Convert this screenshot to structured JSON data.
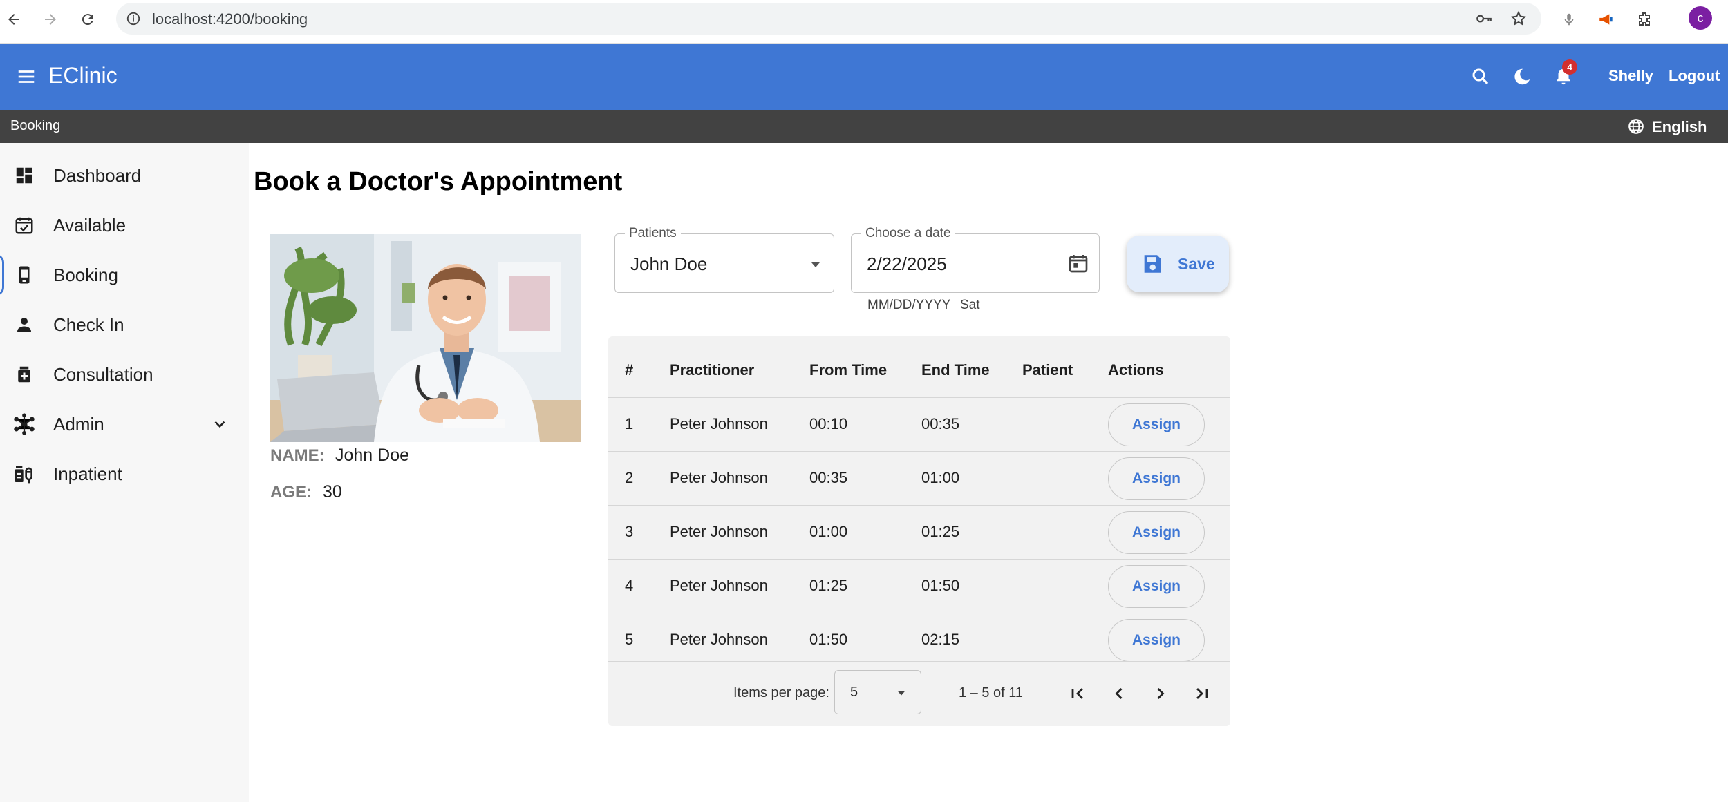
{
  "browser": {
    "url": "localhost:4200/booking",
    "profile_initial": "c",
    "icons": [
      "back-icon",
      "forward-icon",
      "reload-icon",
      "site-info-icon",
      "key-icon",
      "star-icon",
      "mic-icon",
      "megaphone-icon",
      "extensions-icon"
    ]
  },
  "toolbar": {
    "app_name": "EClinic",
    "notification_count": "4",
    "user_name": "Shelly",
    "logout_label": "Logout",
    "color": "#3f77d4"
  },
  "subbar": {
    "breadcrumb": "Booking",
    "language": "English"
  },
  "sidebar": {
    "items": [
      {
        "label": "Dashboard",
        "icon": "dashboard-icon"
      },
      {
        "label": "Available",
        "icon": "calendar-check-icon"
      },
      {
        "label": "Booking",
        "icon": "booking-icon",
        "active": true
      },
      {
        "label": "Check In",
        "icon": "person-icon"
      },
      {
        "label": "Consultation",
        "icon": "medication-icon"
      },
      {
        "label": "Admin",
        "icon": "hub-icon",
        "expandable": true
      },
      {
        "label": "Inpatient",
        "icon": "inpatient-icon"
      }
    ]
  },
  "main": {
    "title": "Book a Doctor's Appointment",
    "patient_info": {
      "name_label": "NAME:",
      "name_value": "John Doe",
      "age_label": "AGE:",
      "age_value": "30"
    },
    "patients_field": {
      "label": "Patients",
      "value": "John Doe"
    },
    "date_field": {
      "label": "Choose a date",
      "value": "2/22/2025",
      "format_hint": "MM/DD/YYYY",
      "weekday": "Sat"
    },
    "save_label": "Save",
    "table": {
      "headers": [
        "#",
        "Practitioner",
        "From Time",
        "End Time",
        "Patient",
        "Actions"
      ],
      "rows": [
        {
          "num": "1",
          "practitioner": "Peter Johnson",
          "from": "00:10",
          "end": "00:35",
          "patient": "",
          "action": "Assign"
        },
        {
          "num": "2",
          "practitioner": "Peter Johnson",
          "from": "00:35",
          "end": "01:00",
          "patient": "",
          "action": "Assign"
        },
        {
          "num": "3",
          "practitioner": "Peter Johnson",
          "from": "01:00",
          "end": "01:25",
          "patient": "",
          "action": "Assign"
        },
        {
          "num": "4",
          "practitioner": "Peter Johnson",
          "from": "01:25",
          "end": "01:50",
          "patient": "",
          "action": "Assign"
        },
        {
          "num": "5",
          "practitioner": "Peter Johnson",
          "from": "01:50",
          "end": "02:15",
          "patient": "",
          "action": "Assign"
        }
      ]
    },
    "paginator": {
      "items_per_page_label": "Items per page:",
      "items_per_page": "5",
      "range": "1 – 5 of 11"
    }
  }
}
